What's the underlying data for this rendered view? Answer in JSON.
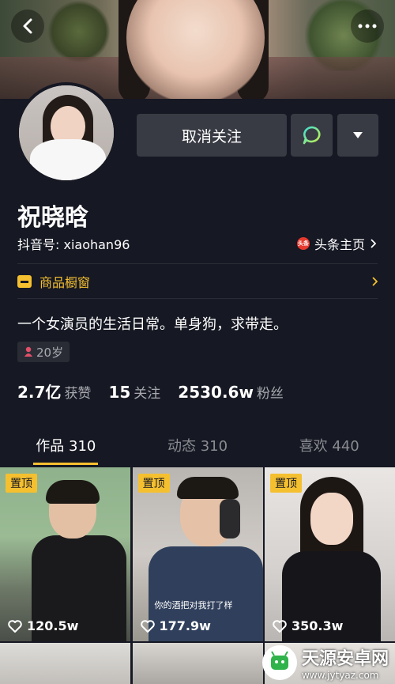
{
  "profile": {
    "name": "祝晓晗",
    "douyin_id": "抖音号: xiaohan96",
    "toutiao_label": "头条主页",
    "toutiao_badge": "头条",
    "shop_label": "商品橱窗",
    "bio": "一个女演员的生活日常。单身狗，求带走。",
    "age": "20岁"
  },
  "actions": {
    "unfollow_label": "取消关注"
  },
  "stats": [
    {
      "num": "2.7亿",
      "label": "获赞"
    },
    {
      "num": "15",
      "label": "关注"
    },
    {
      "num": "2530.6w",
      "label": "粉丝"
    }
  ],
  "tabs": [
    {
      "label": "作品 310"
    },
    {
      "label": "动态 310"
    },
    {
      "label": "喜欢 440"
    }
  ],
  "videos": [
    {
      "pinned": "置顶",
      "likes": "120.5w",
      "caption": ""
    },
    {
      "pinned": "置顶",
      "likes": "177.9w",
      "caption": "你的酒把对我打了样"
    },
    {
      "pinned": "置顶",
      "likes": "350.3w",
      "caption": ""
    }
  ],
  "watermark": {
    "title": "天源安卓网",
    "url": "www.jytyaz.com"
  },
  "colors": {
    "background": "#161823",
    "button": "#393b44",
    "accent": "#f5c030",
    "muted": "#a9aab0"
  }
}
